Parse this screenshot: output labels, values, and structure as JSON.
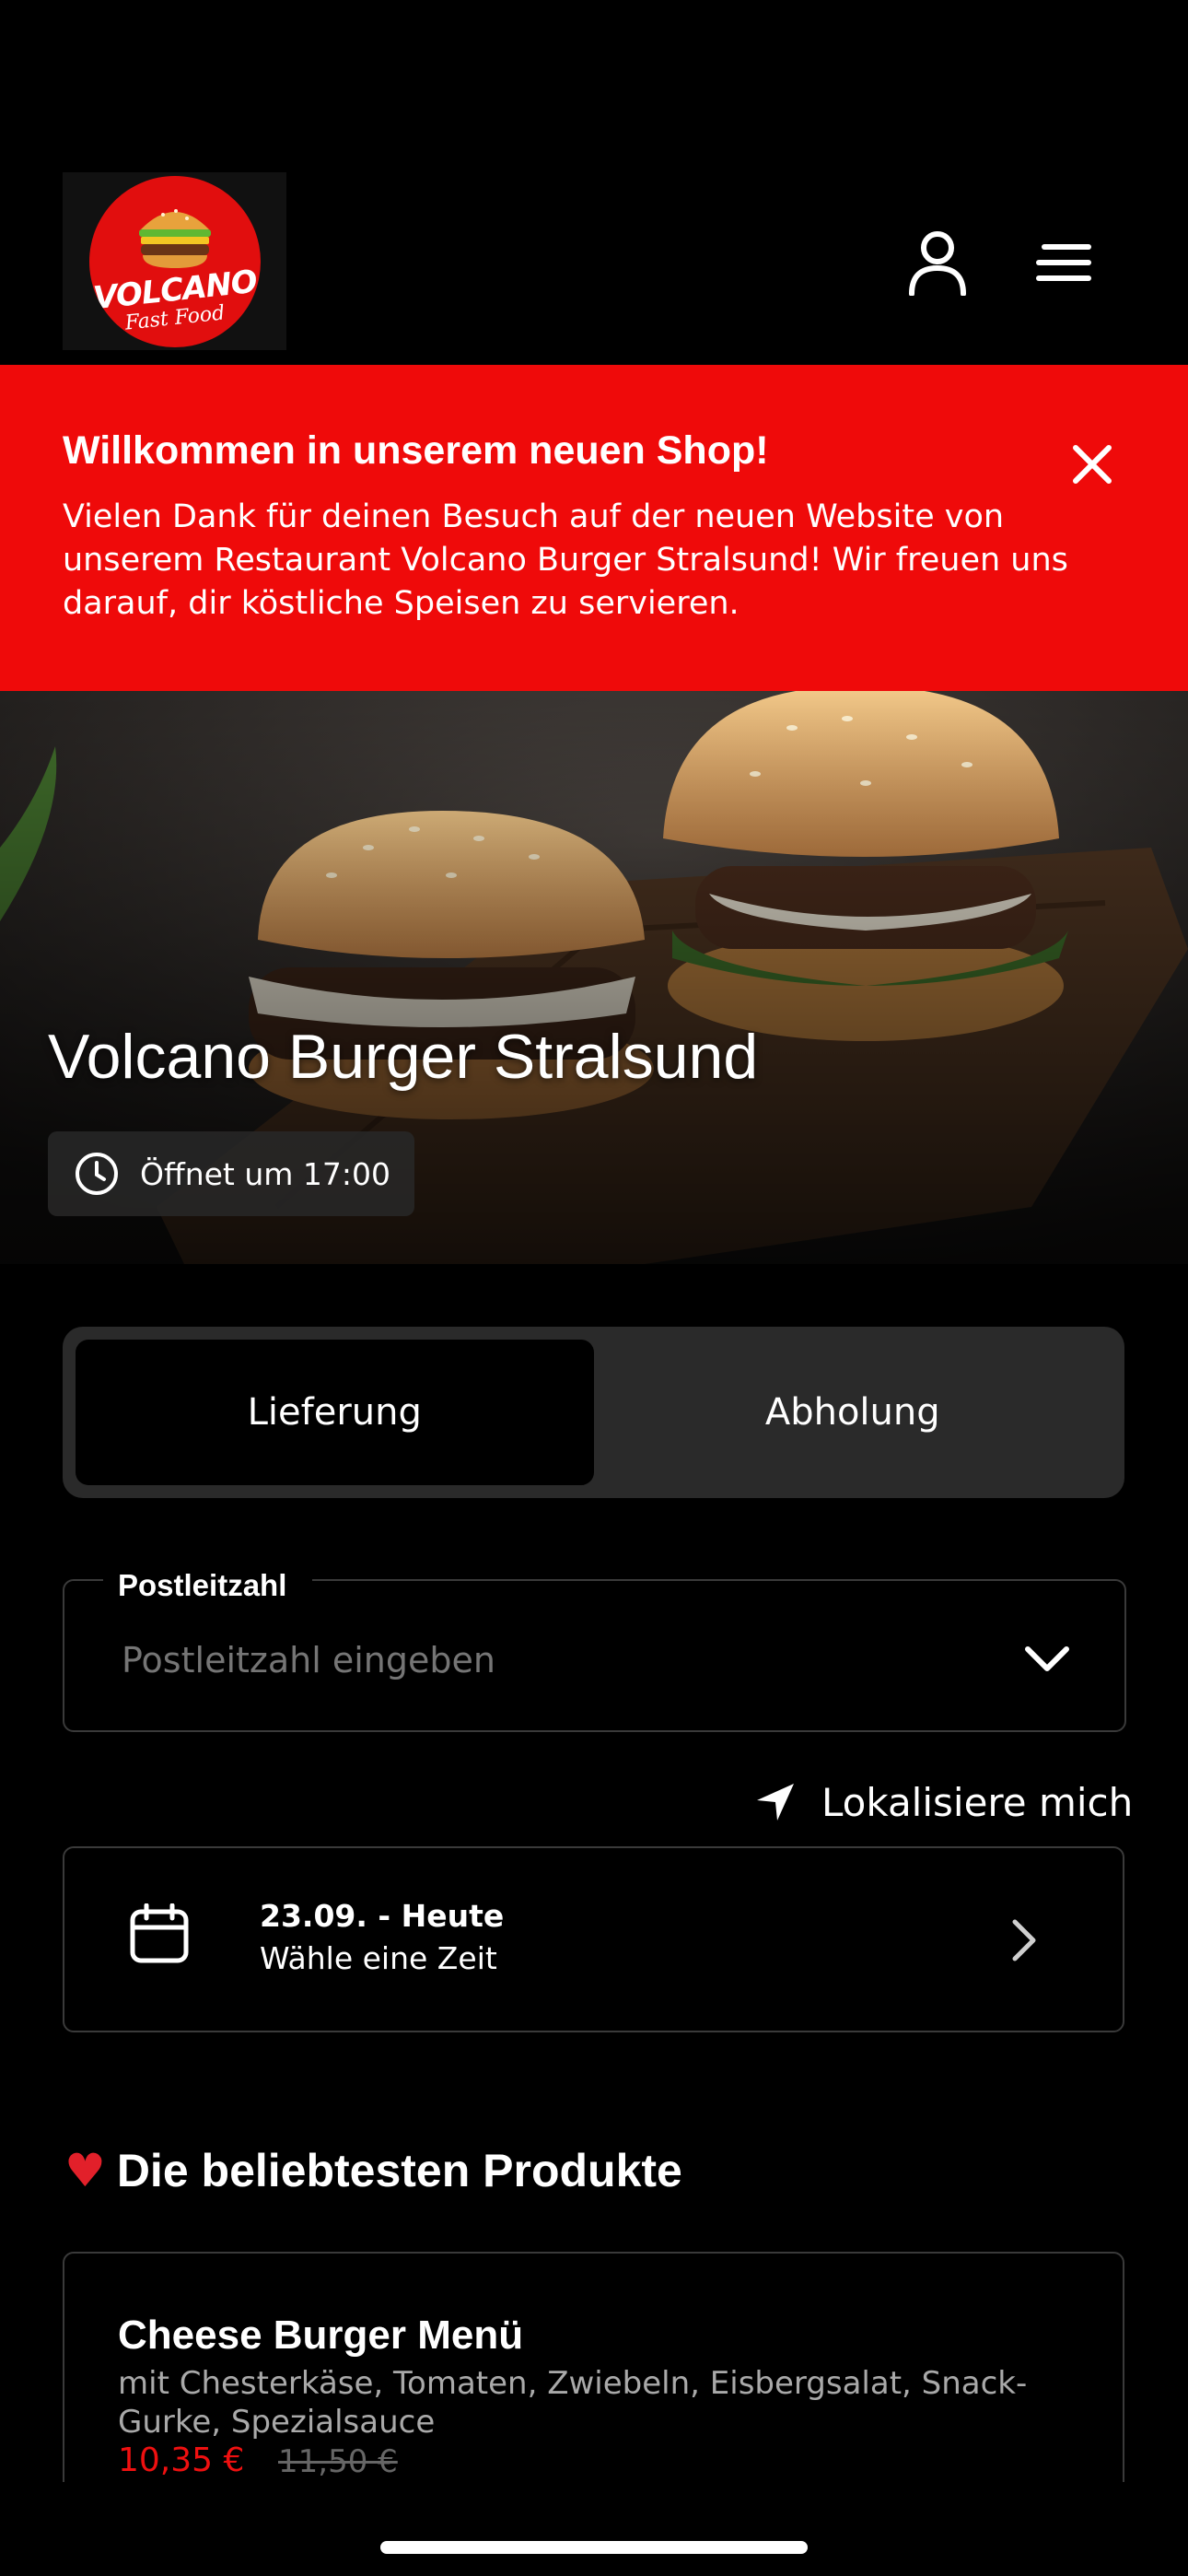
{
  "header": {
    "logo": {
      "text_main": "VOLCANO",
      "text_sub": "Fast Food",
      "color": "#e10e0e"
    },
    "icons": [
      "user-icon",
      "menu-icon"
    ]
  },
  "banner": {
    "title": "Willkommen in unserem neuen Shop!",
    "text": "Vielen Dank für deinen Besuch auf der neuen Website von unserem Restaurant Volcano Burger Stralsund! Wir freuen uns darauf, dir köstliche Speisen zu servieren.",
    "color": "#ef0a0a"
  },
  "hero": {
    "title": "Volcano Burger Stralsund",
    "hours": "Öffnet um 17:00"
  },
  "order_mode": {
    "options": [
      "Lieferung",
      "Abholung"
    ],
    "selected": "Lieferung"
  },
  "postal": {
    "label": "Postleitzahl",
    "placeholder": "Postleitzahl eingeben",
    "value": ""
  },
  "locate": {
    "label": "Lokalisiere mich"
  },
  "date": {
    "title": "23.09. - Heute",
    "subtitle": "Wähle eine Zeit"
  },
  "popular": {
    "title": "Die beliebtesten Produkte",
    "items": [
      {
        "name": "Cheese Burger Menü",
        "description": "mit Chesterkäse, Tomaten, Zwiebeln,  Eisbergsalat, Snack-Gurke, Spezialsauce",
        "price": "10,35 €",
        "old_price": "11,50 €"
      }
    ]
  }
}
